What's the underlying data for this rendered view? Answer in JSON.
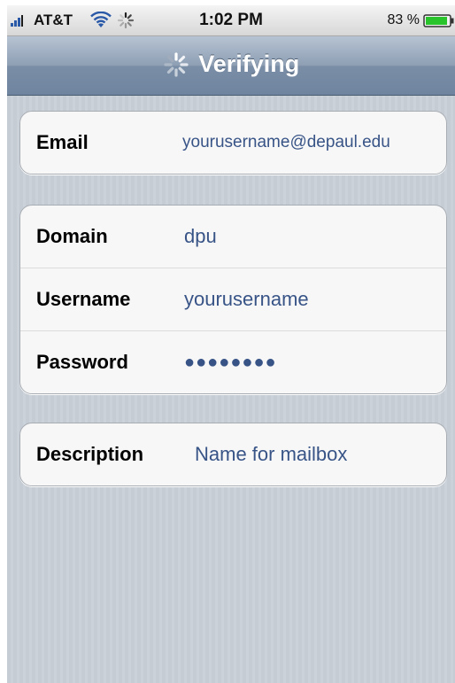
{
  "status_bar": {
    "carrier": "AT&T",
    "time": "1:02 PM",
    "battery_percent": "83 %",
    "signal_icon": "signal-bars-icon",
    "wifi_icon": "wifi-icon",
    "activity_icon": "network-activity-icon",
    "battery_icon": "battery-icon"
  },
  "nav": {
    "title": "Verifying",
    "spinner_icon": "activity-spinner-icon"
  },
  "account_group": {
    "email_label": "Email",
    "email_value": "yourusername@depaul.edu"
  },
  "server_group": {
    "domain_label": "Domain",
    "domain_value": "dpu",
    "username_label": "Username",
    "username_value": "yourusername",
    "password_label": "Password",
    "password_value": "●●●●●●●●"
  },
  "description_group": {
    "description_label": "Description",
    "description_value": "Name for mailbox"
  },
  "colors": {
    "background": "#c5ccd4",
    "navbar": "#7a8ea6",
    "value_text": "#385487",
    "signal": "#2a59a8",
    "battery": "#29c32c"
  }
}
